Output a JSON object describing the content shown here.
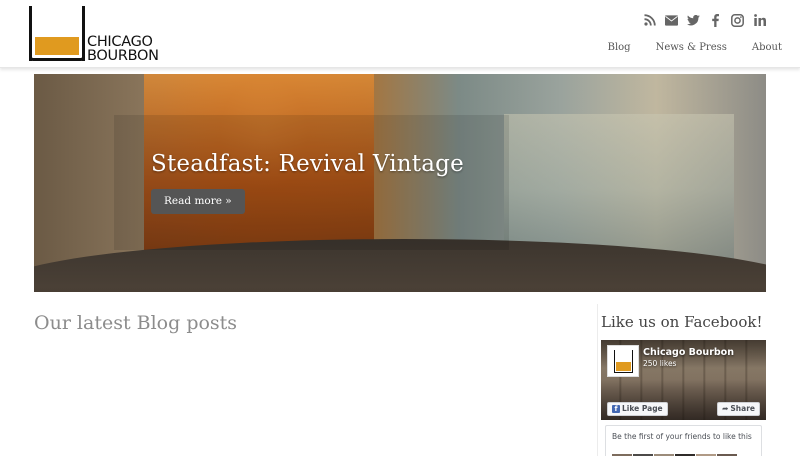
{
  "header": {
    "logo": {
      "line1": "CHICAGO",
      "line2": "BOURBON"
    },
    "social_icons": [
      "rss-icon",
      "envelope-icon",
      "twitter-icon",
      "facebook-icon",
      "instagram-icon",
      "linkedin-icon"
    ],
    "nav": [
      {
        "label": "Blog"
      },
      {
        "label": "News & Press"
      },
      {
        "label": "About"
      }
    ]
  },
  "hero": {
    "title": "Steadfast: Revival Vintage",
    "button_label": "Read more »"
  },
  "main": {
    "heading": "Our latest Blog posts"
  },
  "sidebar": {
    "heading": "Like us on Facebook!",
    "facebook": {
      "page_name": "Chicago Bourbon",
      "likes": "250 likes",
      "like_button": "Like Page",
      "share_button": "Share",
      "friends_text": "Be the first of your friends to like this"
    }
  },
  "colors": {
    "accent": "#e09a1f",
    "facebook_blue": "#4267b2",
    "button_dark": "#555555"
  }
}
